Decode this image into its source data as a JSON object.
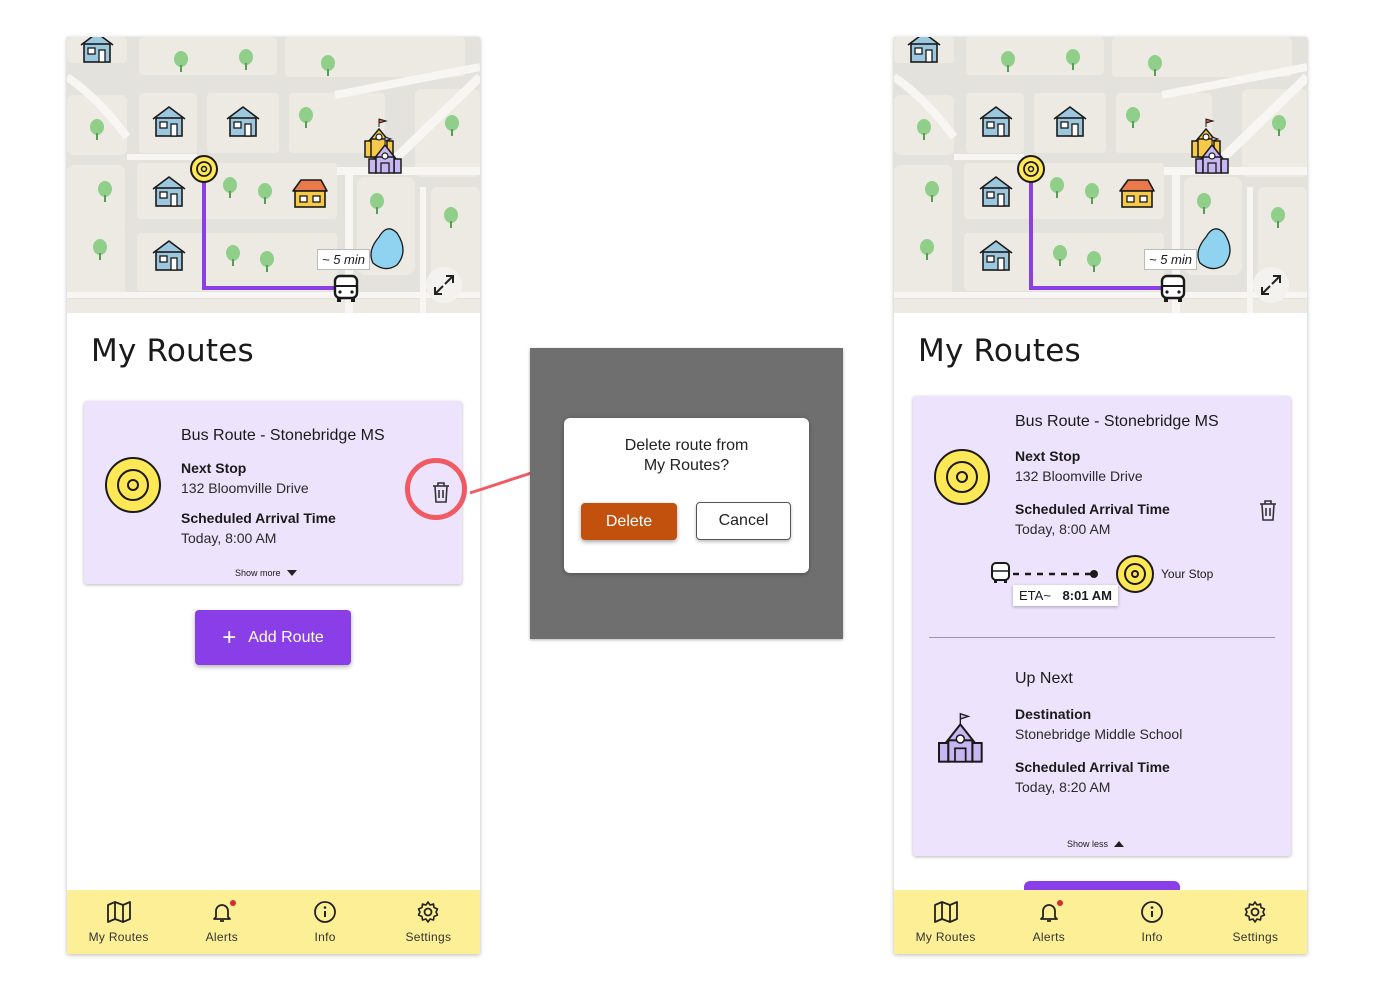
{
  "map": {
    "eta_label": "~ 5 min"
  },
  "page_title": "My Routes",
  "route_card": {
    "title": "Bus Route - Stonebridge MS",
    "next_stop_label": "Next Stop",
    "next_stop_value": "132 Bloomville Drive",
    "arrival_label": "Scheduled Arrival Time",
    "arrival_value": "Today, 8:00 AM",
    "show_more": "Show more",
    "show_less": "Show less",
    "eta_prefix": "ETA~",
    "eta_time": "8:01 AM",
    "your_stop": "Your Stop",
    "up_next": "Up Next",
    "destination_label": "Destination",
    "destination_value": "Stonebridge Middle School",
    "dest_arrival_label": "Scheduled Arrival Time",
    "dest_arrival_value": "Today, 8:20 AM"
  },
  "add_route_label": "Add Route",
  "dialog": {
    "message_line1": "Delete route from",
    "message_line2": "My Routes?",
    "delete_label": "Delete",
    "cancel_label": "Cancel"
  },
  "nav": [
    {
      "label": "My Routes",
      "icon": "map-icon"
    },
    {
      "label": "Alerts",
      "icon": "bell-icon"
    },
    {
      "label": "Info",
      "icon": "info-icon"
    },
    {
      "label": "Settings",
      "icon": "gear-icon"
    }
  ],
  "colors": {
    "accent": "#8a3ee8",
    "card_bg": "#ede3fc",
    "nav_bg": "#fdef96",
    "delete": "#c1510d",
    "callout": "#f05a62",
    "target": "#ffe855"
  }
}
